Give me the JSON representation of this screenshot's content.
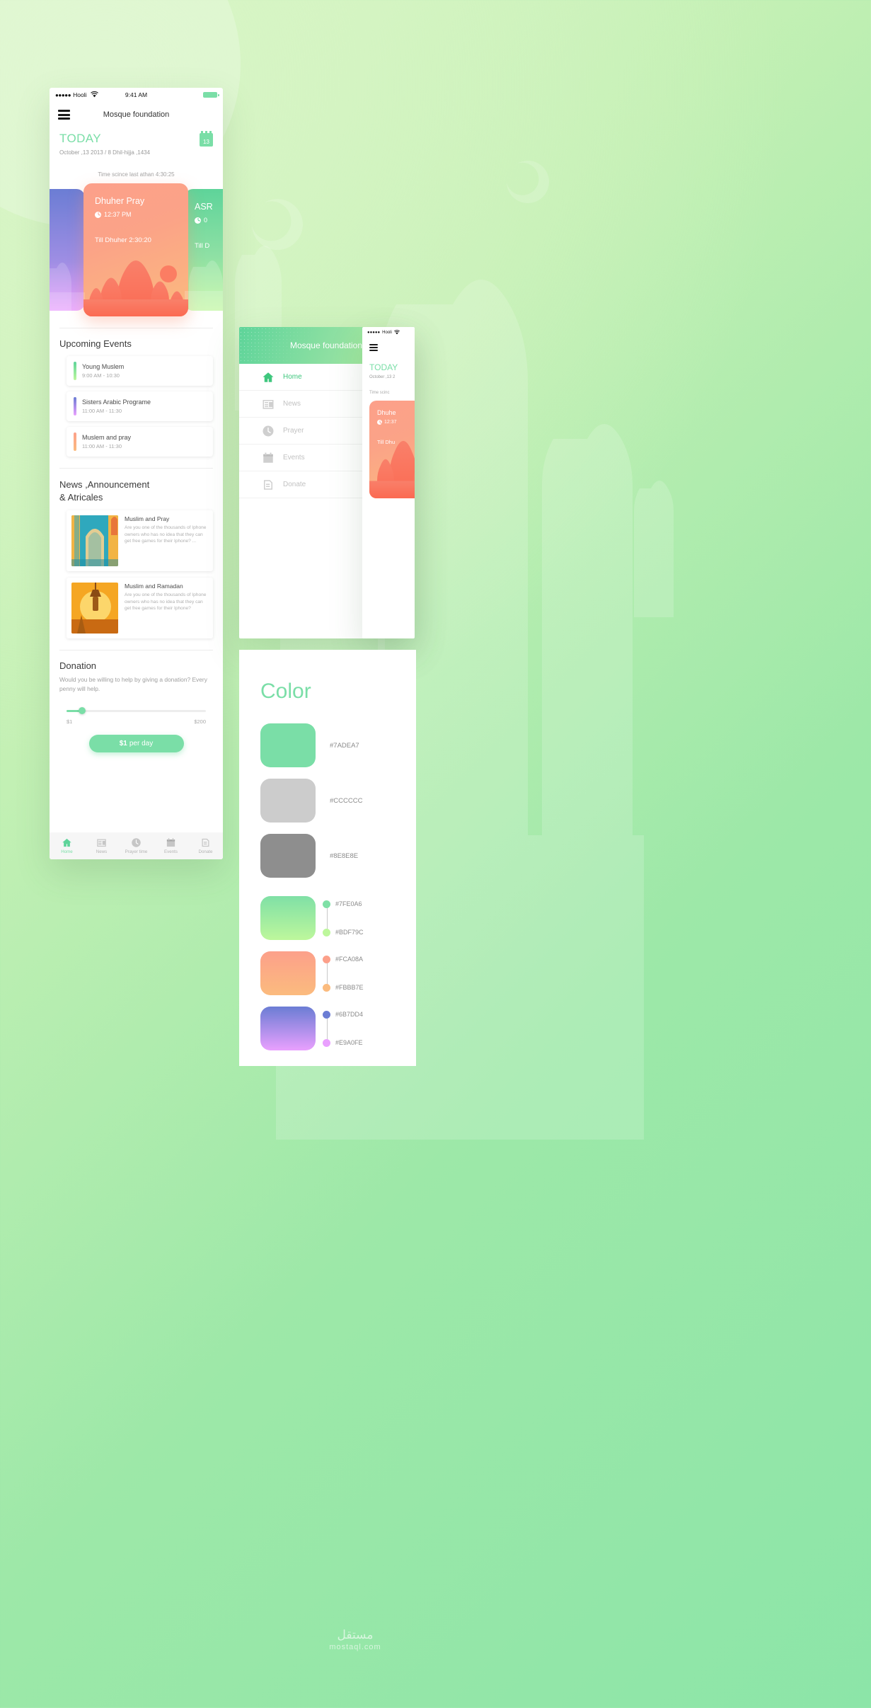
{
  "background": {
    "gradient_from": "#D9F6C4",
    "gradient_to": "#8CE5A8",
    "watermark_ar": "مستقل",
    "watermark_en": "mostaql.com"
  },
  "main_phone": {
    "status_bar": {
      "signal_dots": "●●●●●",
      "carrier": "Hooli",
      "wifi_icon": "wifi-icon",
      "time": "9:41 AM",
      "battery_icon": "battery-icon"
    },
    "app_bar": {
      "menu_icon": "hamburger-menu-icon",
      "title": "Mosque foundation"
    },
    "today": {
      "heading": "TODAY",
      "date": "October ,13 2013 / 8 Dhil-hijja ,1434",
      "calendar_day": "13",
      "calendar_icon": "calendar-icon"
    },
    "athan_note": "Time scince last athan 4:30:25",
    "prayer_cards": [
      {
        "name": "",
        "time": "",
        "till": "",
        "color_from": "#6B7DD4",
        "color_to": "#E9A0FE"
      },
      {
        "name": "Dhuher Pray",
        "time": "12:37 PM",
        "till": "Till Dhuher 2:30:20",
        "color_from": "#FCA08A",
        "color_to": "#FBBB7E"
      },
      {
        "name": "ASR",
        "time": "0",
        "till": "Till D",
        "color_from": "#7FE0A6",
        "color_to": "#BDF79C"
      }
    ],
    "events_section": {
      "title": "Upcoming Events",
      "items": [
        {
          "name": "Young Muslem",
          "time": "9:00 AM - 10:30",
          "accent_from": "#5ED49A",
          "accent_to": "#BDF79C"
        },
        {
          "name": "Sisters Arabic Programe",
          "time": "11:00 AM - 11:30",
          "accent_from": "#6B7DD4",
          "accent_to": "#E9A0FE"
        },
        {
          "name": "Muslem and pray",
          "time": "11:00 AM - 11:30",
          "accent_from": "#FCA08A",
          "accent_to": "#FBBB7E"
        }
      ]
    },
    "news_section": {
      "title_line1": "News ,Announcement",
      "title_line2": "& Atricales",
      "items": [
        {
          "title": "Muslim and Pray",
          "body": "Are you one of the thousands of Iphone owners who has no idea that they can get free games for their Iphone? ...",
          "thumb_icon": "mosque-arch-photo"
        },
        {
          "title": "Muslim and Ramadan",
          "body": "Are you one of the thousands of Iphone owners who has no idea that they can get free games for their Iphone?",
          "thumb_icon": "lantern-sunset-photo"
        }
      ]
    },
    "donation_section": {
      "title": "Donation",
      "description": "Would you be willing to help by giving a donation? Every penny will help.",
      "slider_min_label": "$1",
      "slider_max_label": "$200",
      "button_amount": "$1",
      "button_suffix": "per day"
    },
    "tab_bar": [
      {
        "label": "Home",
        "icon": "home-icon",
        "active": true
      },
      {
        "label": "News",
        "icon": "news-icon",
        "active": false
      },
      {
        "label": "Prayer time",
        "icon": "clock-icon",
        "active": false
      },
      {
        "label": "Events",
        "icon": "calendar-icon",
        "active": false
      },
      {
        "label": "Donate",
        "icon": "donate-icon",
        "active": false
      }
    ]
  },
  "drawer_phone": {
    "header_title": "Mosque foundation",
    "items": [
      {
        "label": "Home",
        "icon": "home-icon",
        "active": true
      },
      {
        "label": "News",
        "icon": "news-icon",
        "active": false
      },
      {
        "label": "Prayer",
        "icon": "clock-icon",
        "active": false
      },
      {
        "label": "Events",
        "icon": "calendar-icon",
        "active": false
      },
      {
        "label": "Donate",
        "icon": "donate-icon",
        "active": false
      }
    ]
  },
  "mini_phone": {
    "status_bar": {
      "signal_dots": "●●●●●",
      "carrier": "Hooli",
      "wifi_icon": "wifi-icon"
    },
    "menu_icon": "hamburger-menu-icon",
    "today_heading": "TODAY",
    "date": "October ,13 2",
    "athan_note": "Time scinc",
    "card_title": "Dhuhe",
    "card_time": "12:37",
    "card_till": "Till Dhu"
  },
  "color_panel": {
    "title": "Color",
    "solid_swatches": [
      {
        "hex": "#7ADEA7",
        "label": "#7ADEA7"
      },
      {
        "hex": "#CCCCCC",
        "label": "#CCCCCC"
      },
      {
        "hex": "#8E8E8E",
        "label": "#8E8E8E"
      }
    ],
    "gradient_swatches": [
      {
        "from": "#7FE0A6",
        "to": "#BDF79C",
        "from_label": "#7FE0A6",
        "to_label": "#BDF79C"
      },
      {
        "from": "#FCA08A",
        "to": "#FBBB7E",
        "from_label": "#FCA08A",
        "to_label": "#FBBB7E"
      },
      {
        "from": "#6B7DD4",
        "to": "#E9A0FE",
        "from_label": "#6B7DD4",
        "to_label": "#E9A0FE"
      }
    ]
  }
}
